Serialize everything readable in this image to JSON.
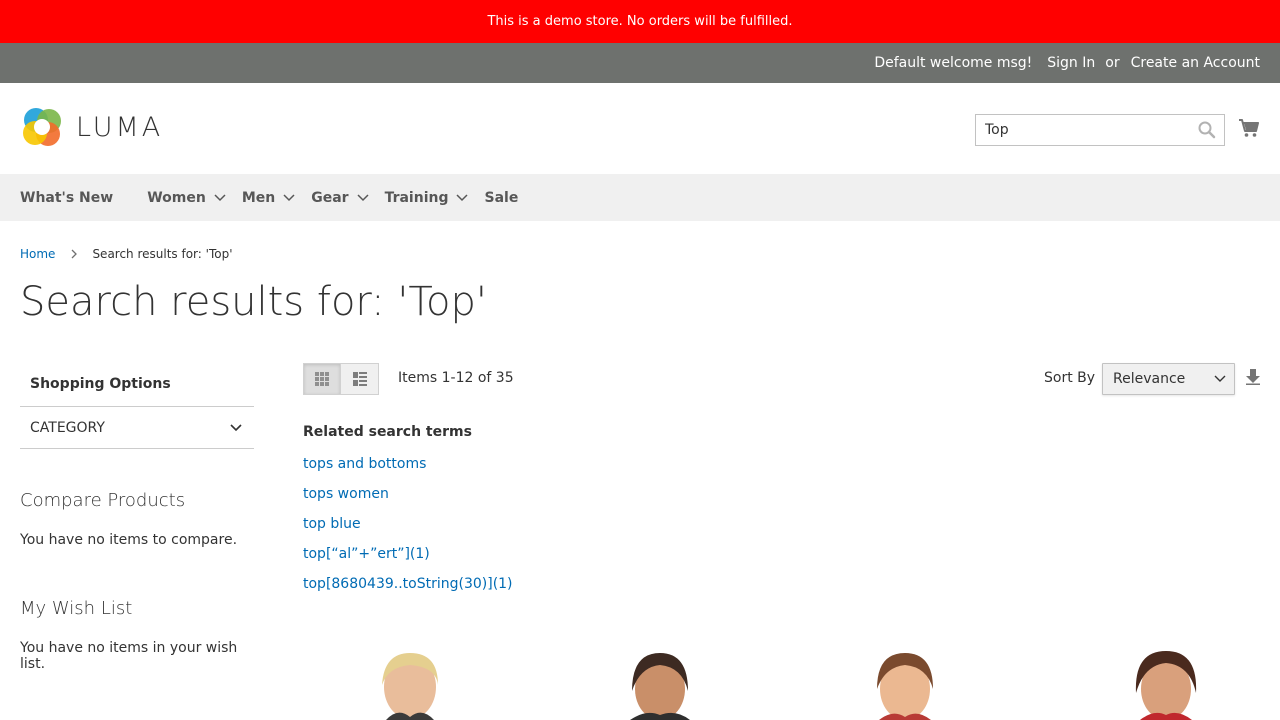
{
  "banner": {
    "text": "This is a demo store. No orders will be fulfilled.",
    "color": "#ff0000"
  },
  "top_bar": {
    "welcome": "Default welcome msg!",
    "sign_in": "Sign In",
    "or": "or",
    "create_account": "Create an Account"
  },
  "header": {
    "logo_text": "LUMA",
    "search_value": "Top",
    "search_icon": "search-icon",
    "cart_icon": "cart-icon"
  },
  "nav": {
    "items": [
      {
        "label": "What's New",
        "has_submenu": false
      },
      {
        "label": "Women",
        "has_submenu": true
      },
      {
        "label": "Men",
        "has_submenu": true
      },
      {
        "label": "Gear",
        "has_submenu": true
      },
      {
        "label": "Training",
        "has_submenu": true
      },
      {
        "label": "Sale",
        "has_submenu": false
      }
    ]
  },
  "breadcrumb": {
    "home": "Home",
    "current": "Search results for: 'Top'"
  },
  "page_title": "Search results for: 'Top'",
  "sidebar": {
    "shopping_options": "Shopping Options",
    "category": "CATEGORY",
    "compare_title": "Compare Products",
    "compare_text": "You have no items to compare.",
    "wishlist_title": "My Wish List",
    "wishlist_text": "You have no items in your wish list."
  },
  "toolbar": {
    "view_modes": [
      "grid",
      "list"
    ],
    "active_mode": "grid",
    "amount": "Items 1-12 of 35",
    "sort_label": "Sort By",
    "sort_value": "Relevance"
  },
  "related": {
    "title": "Related search terms",
    "terms": [
      "tops and bottoms",
      "tops women",
      "top blue",
      "top[“al”+”ert”](1)",
      "top[8680439..toString(30)](1)"
    ]
  },
  "colors": {
    "link": "#006bb4",
    "top_bar": "#6e716e",
    "nav_bg": "#f0f0f0"
  }
}
